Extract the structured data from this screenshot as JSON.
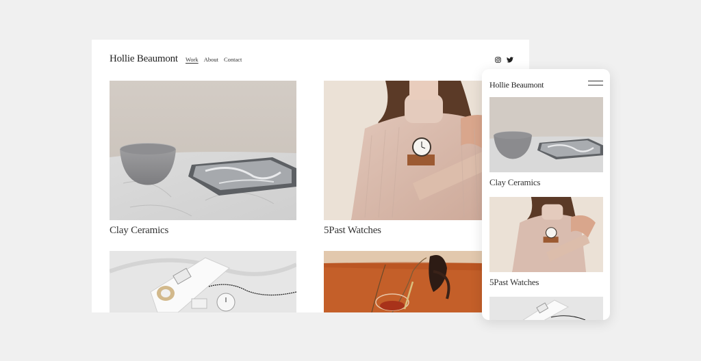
{
  "desktop": {
    "site_title": "Hollie Beaumont",
    "nav": [
      "Work",
      "About",
      "Contact"
    ],
    "social_icons": [
      "instagram-icon",
      "twitter-icon"
    ],
    "projects": [
      {
        "caption": "Clay Ceramics"
      },
      {
        "caption": "5Past Watches"
      },
      {
        "caption": ""
      },
      {
        "caption": ""
      }
    ]
  },
  "mobile": {
    "site_title": "Hollie Beaumont",
    "menu_icon": "hamburger-menu-icon",
    "projects": [
      {
        "caption": "Clay Ceramics"
      },
      {
        "caption": "5Past Watches"
      }
    ]
  }
}
